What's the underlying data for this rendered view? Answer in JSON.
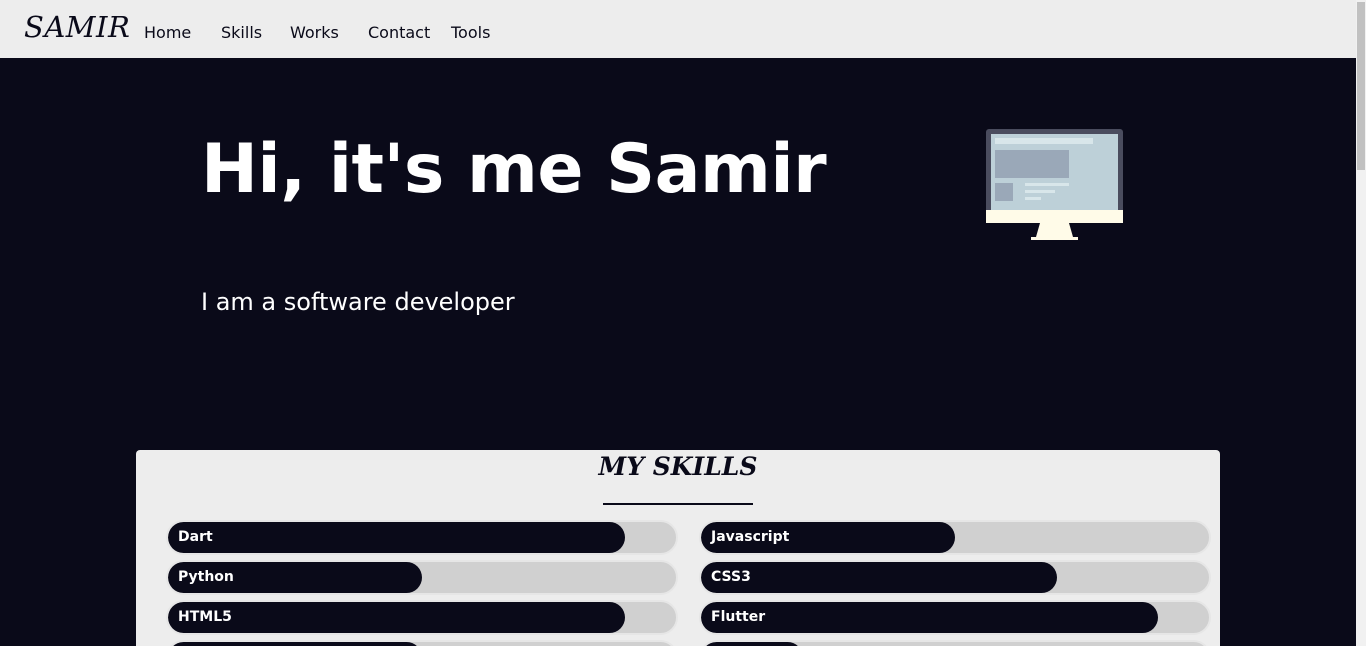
{
  "nav": {
    "brand": "SAMIR",
    "links": [
      "Home",
      "Skills",
      "Works",
      "Contact",
      "Tools"
    ]
  },
  "hero": {
    "title": "Hi, it's me Samir",
    "subtitle": "I am a software developer"
  },
  "skills": {
    "heading": "MY SKILLS",
    "items": [
      {
        "label": "Dart",
        "level": 0.9
      },
      {
        "label": "Javascript",
        "level": 0.5
      },
      {
        "label": "Python",
        "level": 0.5
      },
      {
        "label": "CSS3",
        "level": 0.7
      },
      {
        "label": "HTML5",
        "level": 0.9
      },
      {
        "label": "Flutter",
        "level": 0.9
      }
    ]
  },
  "colors": {
    "dark": "#0a0a19",
    "light": "#ededed",
    "track": "#d0d0d0"
  }
}
